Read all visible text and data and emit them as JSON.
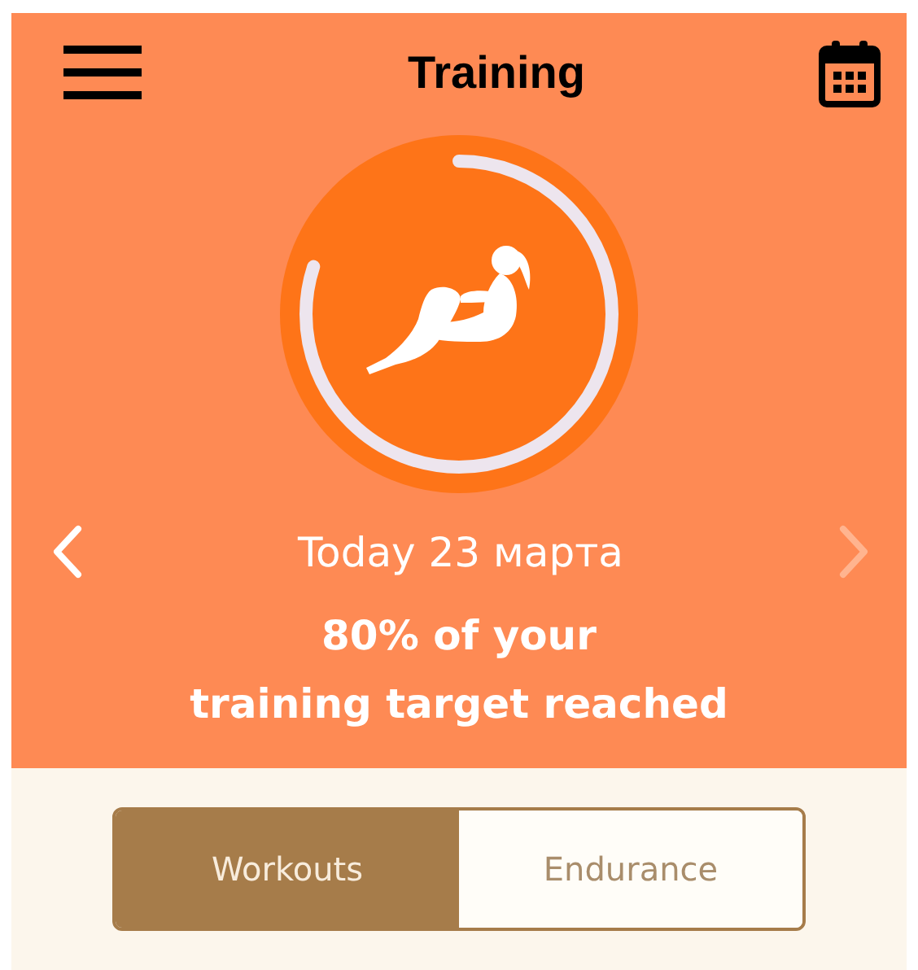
{
  "header": {
    "title": "Training"
  },
  "progress": {
    "level": 0.8
  },
  "date_nav": {
    "label": "Today 23 марта",
    "prev_disabled": false,
    "next_disabled": true
  },
  "summary": "80% of your\ntraining target reached",
  "tabs": [
    {
      "label": "Workouts",
      "selected": true
    },
    {
      "label": "Endurance",
      "selected": false
    }
  ]
}
